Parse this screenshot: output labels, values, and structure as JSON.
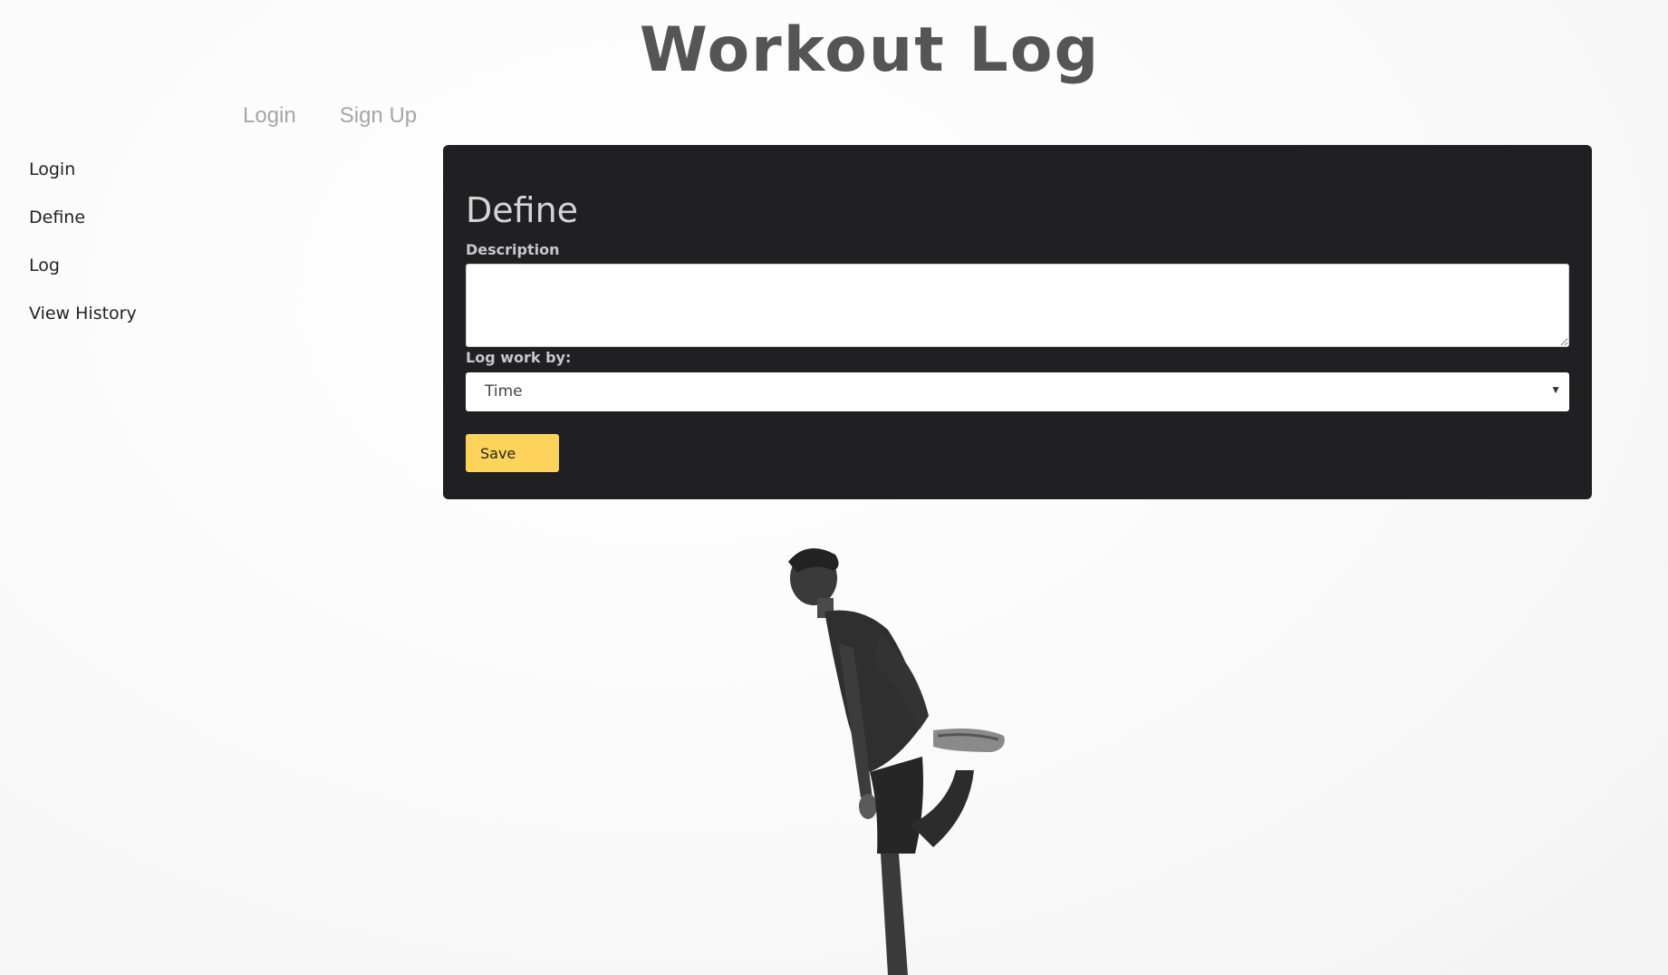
{
  "header": {
    "title": "Workout Log"
  },
  "top_nav": {
    "items": [
      {
        "label": "Login"
      },
      {
        "label": "Sign Up"
      }
    ]
  },
  "sidebar": {
    "items": [
      {
        "label": "Login"
      },
      {
        "label": "Define"
      },
      {
        "label": "Log"
      },
      {
        "label": "View History"
      }
    ]
  },
  "define_panel": {
    "title": "Define",
    "description_label": "Description",
    "description_value": "",
    "log_by_label": "Log work by:",
    "log_by_selected": "Time",
    "save_label": "Save"
  },
  "colors": {
    "panel_bg": "#202022",
    "accent": "#fdd35b",
    "title": "#555555"
  },
  "icons": {
    "select_arrow": "chevron-down-icon"
  }
}
